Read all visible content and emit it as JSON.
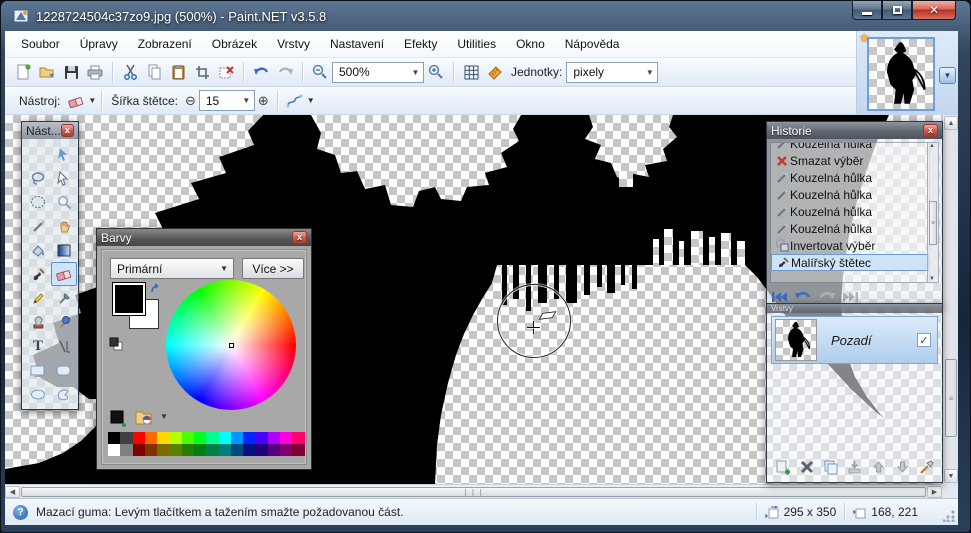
{
  "window": {
    "title": "1228724504c37zo9.jpg (500%) - Paint.NET v3.5.8",
    "controls": {
      "minimize": "minimize",
      "restore": "restore",
      "close": "close"
    }
  },
  "menu": {
    "items": [
      {
        "label": "Soubor"
      },
      {
        "label": "Úpravy"
      },
      {
        "label": "Zobrazení"
      },
      {
        "label": "Obrázek"
      },
      {
        "label": "Vrstvy"
      },
      {
        "label": "Nastavení"
      },
      {
        "label": "Efekty"
      },
      {
        "label": "Utilities"
      },
      {
        "label": "Okno"
      },
      {
        "label": "Nápověda"
      }
    ]
  },
  "toolbar": {
    "zoom_value": "500%",
    "units_label": "Jednotky:",
    "units_value": "pixely",
    "icons": [
      "new-file-icon",
      "open-file-icon",
      "save-icon",
      "print-icon",
      "cut-icon",
      "copy-icon",
      "paste-icon",
      "crop-icon",
      "deselect-icon",
      "undo-icon",
      "redo-icon",
      "zoom-out-icon",
      "zoom-in-icon",
      "grid-icon",
      "ruler-icon"
    ]
  },
  "toolbar2": {
    "tool_label": "Nástroj:",
    "active_tool": "eraser",
    "brush_width_label": "Šířka štětce:",
    "brush_width_value": "15",
    "minus_glyph": "⊖",
    "plus_glyph": "⊕"
  },
  "tools_palette": {
    "title": "Nást...",
    "selected_tool": "eraser",
    "tools": [
      "rectangle-select",
      "move-selected-pixels",
      "lasso-select",
      "move-selection",
      "ellipse-select",
      "zoom-tool",
      "magic-wand",
      "pan-tool",
      "paint-bucket",
      "gradient-tool",
      "paintbrush",
      "eraser",
      "pencil",
      "color-picker",
      "clone-stamp",
      "recolor-tool",
      "text-tool",
      "line-curve",
      "rectangle-shape",
      "rounded-rectangle",
      "ellipse-shape",
      "freeform-shape"
    ]
  },
  "colors_dialog": {
    "title": "Barvy",
    "mode_value": "Primární",
    "more_label": "Více >>",
    "primary_color": "#000000",
    "secondary_color": "#FFFFFF",
    "palette_row1": [
      "#000000",
      "#404040",
      "#FF0000",
      "#FF6A00",
      "#FFD800",
      "#B6FF00",
      "#4CFF00",
      "#00FF21",
      "#00FF90",
      "#00FFFF",
      "#0094FF",
      "#0026FF",
      "#4800FF",
      "#B200FF",
      "#FF00DC",
      "#FF006E"
    ],
    "palette_row2": [
      "#FFFFFF",
      "#808080",
      "#7F0000",
      "#7F3300",
      "#7F6A00",
      "#5B7F00",
      "#267F00",
      "#007F0E",
      "#007F46",
      "#007F7F",
      "#004A7F",
      "#00137F",
      "#21007F",
      "#57007F",
      "#7F006E",
      "#7F0037"
    ]
  },
  "history_panel": {
    "title": "Historie",
    "items": [
      {
        "label": "Kouzelná hůlka",
        "icon": "magic-wand-icon",
        "selected": false
      },
      {
        "label": "Smazat výběr",
        "icon": "delete-x-icon",
        "selected": false
      },
      {
        "label": "Kouzelná hůlka",
        "icon": "magic-wand-icon",
        "selected": false
      },
      {
        "label": "Kouzelná hůlka",
        "icon": "magic-wand-icon",
        "selected": false
      },
      {
        "label": "Kouzelná hůlka",
        "icon": "magic-wand-icon",
        "selected": false
      },
      {
        "label": "Kouzelná hůlka",
        "icon": "magic-wand-icon",
        "selected": false
      },
      {
        "label": "Invertovat výběr",
        "icon": "invert-selection-icon",
        "selected": false
      },
      {
        "label": "Malířský štětec",
        "icon": "paintbrush-icon",
        "selected": true
      }
    ]
  },
  "layers_panel": {
    "title": "Vrstvy",
    "layers": [
      {
        "name": "Pozadí",
        "visible": true,
        "check_glyph": "✓"
      }
    ]
  },
  "status_bar": {
    "message": "Mazací guma: Levým tlačítkem a tažením smažte požadovanou část.",
    "image_size": "295 x 350",
    "cursor_position": "168, 221"
  },
  "colors": {
    "titlebar_close": "#c0392b",
    "selection_highlight": "#cfe3f7",
    "canvas_black": "#000000",
    "checker_gray": "#c6c6c6"
  }
}
